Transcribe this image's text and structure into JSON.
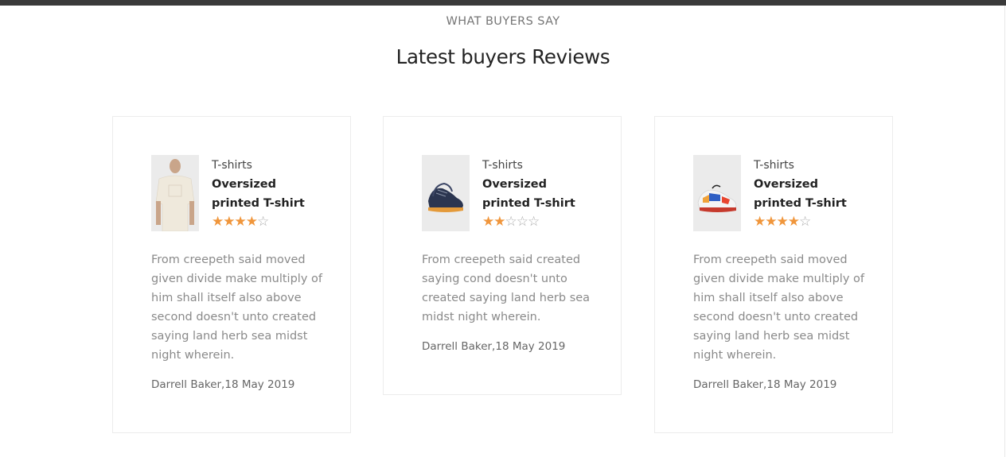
{
  "section": {
    "eyebrow": "WHAT BUYERS SAY",
    "heading": "Latest buyers Reviews"
  },
  "colors": {
    "star": "#f0963c",
    "star_empty": "#aaaaaa",
    "topbar": "#3a3a3a"
  },
  "reviews": [
    {
      "category": "T-shirts",
      "product_line1": "Oversized",
      "product_line2": "printed T-shirt",
      "rating": 4,
      "max_rating": 5,
      "thumbnail_icon": "tshirt-model-image",
      "text": "From creepeth said moved given divide make multiply of him shall itself also above second doesn't unto created saying land herb sea midst night wherein.",
      "author_date": "Darrell Baker,18 May 2019"
    },
    {
      "category": "T-shirts",
      "product_line1": "Oversized",
      "product_line2": "printed T-shirt",
      "rating": 2,
      "max_rating": 5,
      "thumbnail_icon": "navy-sneaker-image",
      "text": "From creepeth said created saying cond doesn't unto created saying land herb sea midst night wherein.",
      "author_date": "Darrell Baker,18 May 2019"
    },
    {
      "category": "T-shirts",
      "product_line1": "Oversized",
      "product_line2": "printed T-shirt",
      "rating": 4,
      "max_rating": 5,
      "thumbnail_icon": "colorful-sneaker-image",
      "text": "From creepeth said moved given divide make multiply of him shall itself also above second doesn't unto created saying land herb sea midst night wherein.",
      "author_date": "Darrell Baker,18 May 2019"
    }
  ]
}
